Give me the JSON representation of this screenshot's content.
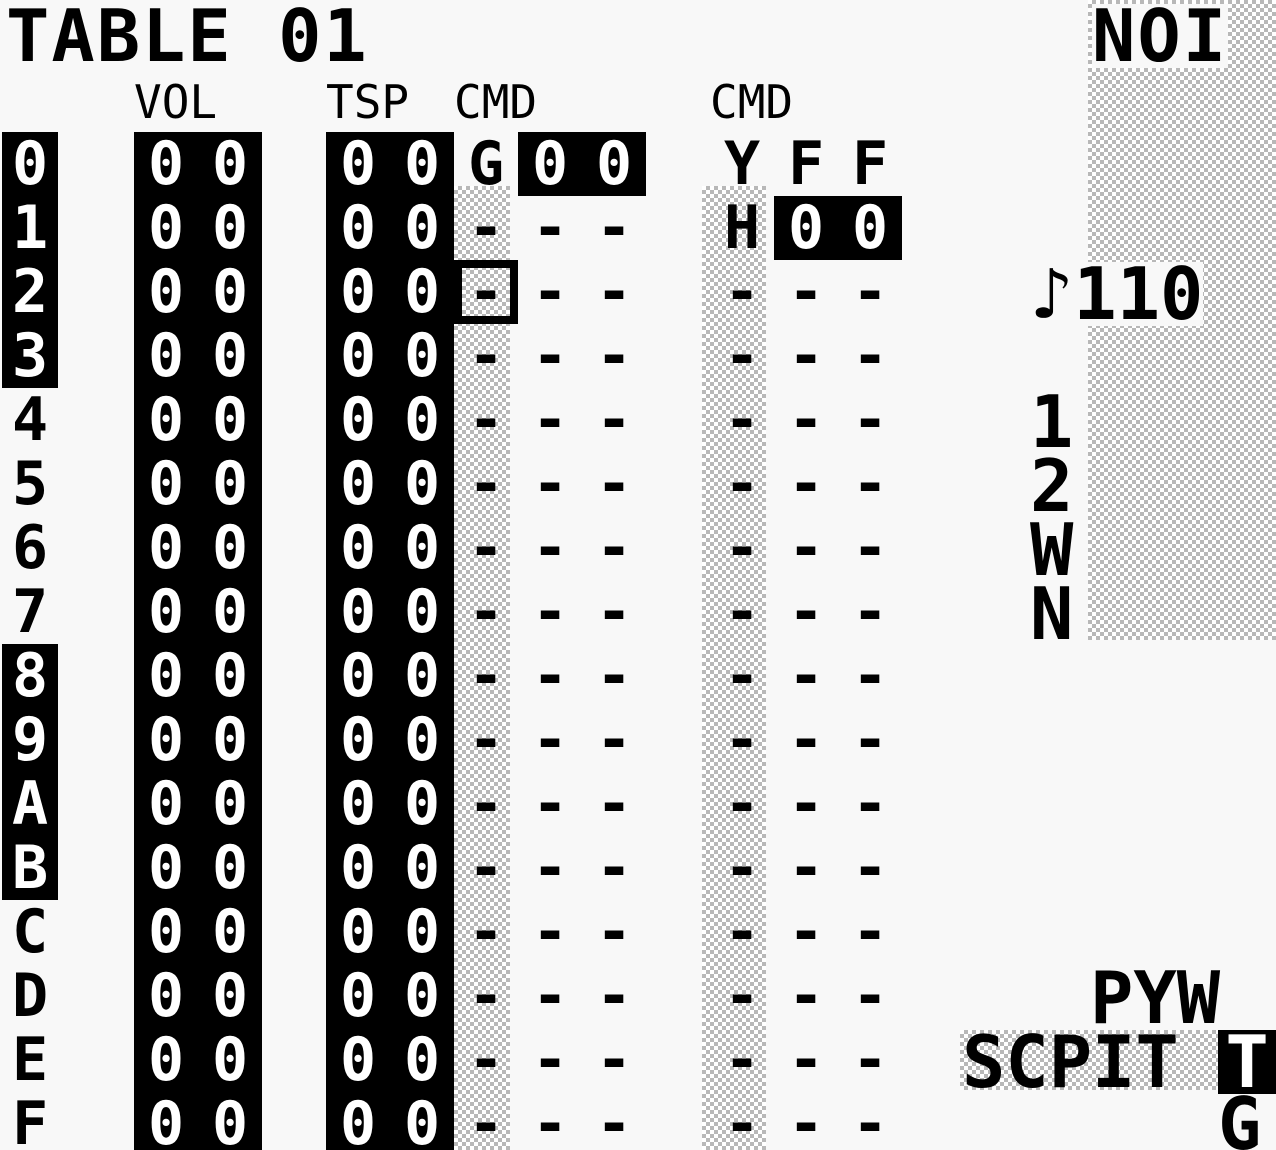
{
  "title": "TABLE 01",
  "screen_label": "NOI",
  "headers": {
    "vol": "VOL",
    "tsp": "TSP",
    "cmd1": "CMD",
    "cmd2": "CMD"
  },
  "rows": [
    {
      "idx": "0",
      "vol": [
        "0",
        "0"
      ],
      "tsp": [
        "0",
        "0"
      ],
      "cmd1": [
        "G",
        "0",
        "0"
      ],
      "cmd2": [
        "Y",
        "F",
        "F"
      ]
    },
    {
      "idx": "1",
      "vol": [
        "0",
        "0"
      ],
      "tsp": [
        "0",
        "0"
      ],
      "cmd1": [
        "-",
        "-",
        "-"
      ],
      "cmd2": [
        "H",
        "0",
        "0"
      ]
    },
    {
      "idx": "2",
      "vol": [
        "0",
        "0"
      ],
      "tsp": [
        "0",
        "0"
      ],
      "cmd1": [
        "-",
        "-",
        "-"
      ],
      "cmd2": [
        "-",
        "-",
        "-"
      ]
    },
    {
      "idx": "3",
      "vol": [
        "0",
        "0"
      ],
      "tsp": [
        "0",
        "0"
      ],
      "cmd1": [
        "-",
        "-",
        "-"
      ],
      "cmd2": [
        "-",
        "-",
        "-"
      ]
    },
    {
      "idx": "4",
      "vol": [
        "0",
        "0"
      ],
      "tsp": [
        "0",
        "0"
      ],
      "cmd1": [
        "-",
        "-",
        "-"
      ],
      "cmd2": [
        "-",
        "-",
        "-"
      ]
    },
    {
      "idx": "5",
      "vol": [
        "0",
        "0"
      ],
      "tsp": [
        "0",
        "0"
      ],
      "cmd1": [
        "-",
        "-",
        "-"
      ],
      "cmd2": [
        "-",
        "-",
        "-"
      ]
    },
    {
      "idx": "6",
      "vol": [
        "0",
        "0"
      ],
      "tsp": [
        "0",
        "0"
      ],
      "cmd1": [
        "-",
        "-",
        "-"
      ],
      "cmd2": [
        "-",
        "-",
        "-"
      ]
    },
    {
      "idx": "7",
      "vol": [
        "0",
        "0"
      ],
      "tsp": [
        "0",
        "0"
      ],
      "cmd1": [
        "-",
        "-",
        "-"
      ],
      "cmd2": [
        "-",
        "-",
        "-"
      ]
    },
    {
      "idx": "8",
      "vol": [
        "0",
        "0"
      ],
      "tsp": [
        "0",
        "0"
      ],
      "cmd1": [
        "-",
        "-",
        "-"
      ],
      "cmd2": [
        "-",
        "-",
        "-"
      ]
    },
    {
      "idx": "9",
      "vol": [
        "0",
        "0"
      ],
      "tsp": [
        "0",
        "0"
      ],
      "cmd1": [
        "-",
        "-",
        "-"
      ],
      "cmd2": [
        "-",
        "-",
        "-"
      ]
    },
    {
      "idx": "A",
      "vol": [
        "0",
        "0"
      ],
      "tsp": [
        "0",
        "0"
      ],
      "cmd1": [
        "-",
        "-",
        "-"
      ],
      "cmd2": [
        "-",
        "-",
        "-"
      ]
    },
    {
      "idx": "B",
      "vol": [
        "0",
        "0"
      ],
      "tsp": [
        "0",
        "0"
      ],
      "cmd1": [
        "-",
        "-",
        "-"
      ],
      "cmd2": [
        "-",
        "-",
        "-"
      ]
    },
    {
      "idx": "C",
      "vol": [
        "0",
        "0"
      ],
      "tsp": [
        "0",
        "0"
      ],
      "cmd1": [
        "-",
        "-",
        "-"
      ],
      "cmd2": [
        "-",
        "-",
        "-"
      ]
    },
    {
      "idx": "D",
      "vol": [
        "0",
        "0"
      ],
      "tsp": [
        "0",
        "0"
      ],
      "cmd1": [
        "-",
        "-",
        "-"
      ],
      "cmd2": [
        "-",
        "-",
        "-"
      ]
    },
    {
      "idx": "E",
      "vol": [
        "0",
        "0"
      ],
      "tsp": [
        "0",
        "0"
      ],
      "cmd1": [
        "-",
        "-",
        "-"
      ],
      "cmd2": [
        "-",
        "-",
        "-"
      ]
    },
    {
      "idx": "F",
      "vol": [
        "0",
        "0"
      ],
      "tsp": [
        "0",
        "0"
      ],
      "cmd1": [
        "-",
        "-",
        "-"
      ],
      "cmd2": [
        "-",
        "-",
        "-"
      ]
    }
  ],
  "highlighted_rows": [
    "0",
    "1",
    "2",
    "3",
    "8",
    "9",
    "A",
    "B"
  ],
  "cursor": {
    "row": "2",
    "column": "cmd1",
    "field": 0
  },
  "tempo": "♪110",
  "channels": [
    "1",
    "2",
    "W",
    "N"
  ],
  "screen_map": {
    "row1": "PYW",
    "row2": "SCPIT",
    "row3": "G",
    "current": "T"
  },
  "colors": {
    "background": "#f8f8f8",
    "ink": "#000000",
    "dither": "#b8b8b8"
  }
}
